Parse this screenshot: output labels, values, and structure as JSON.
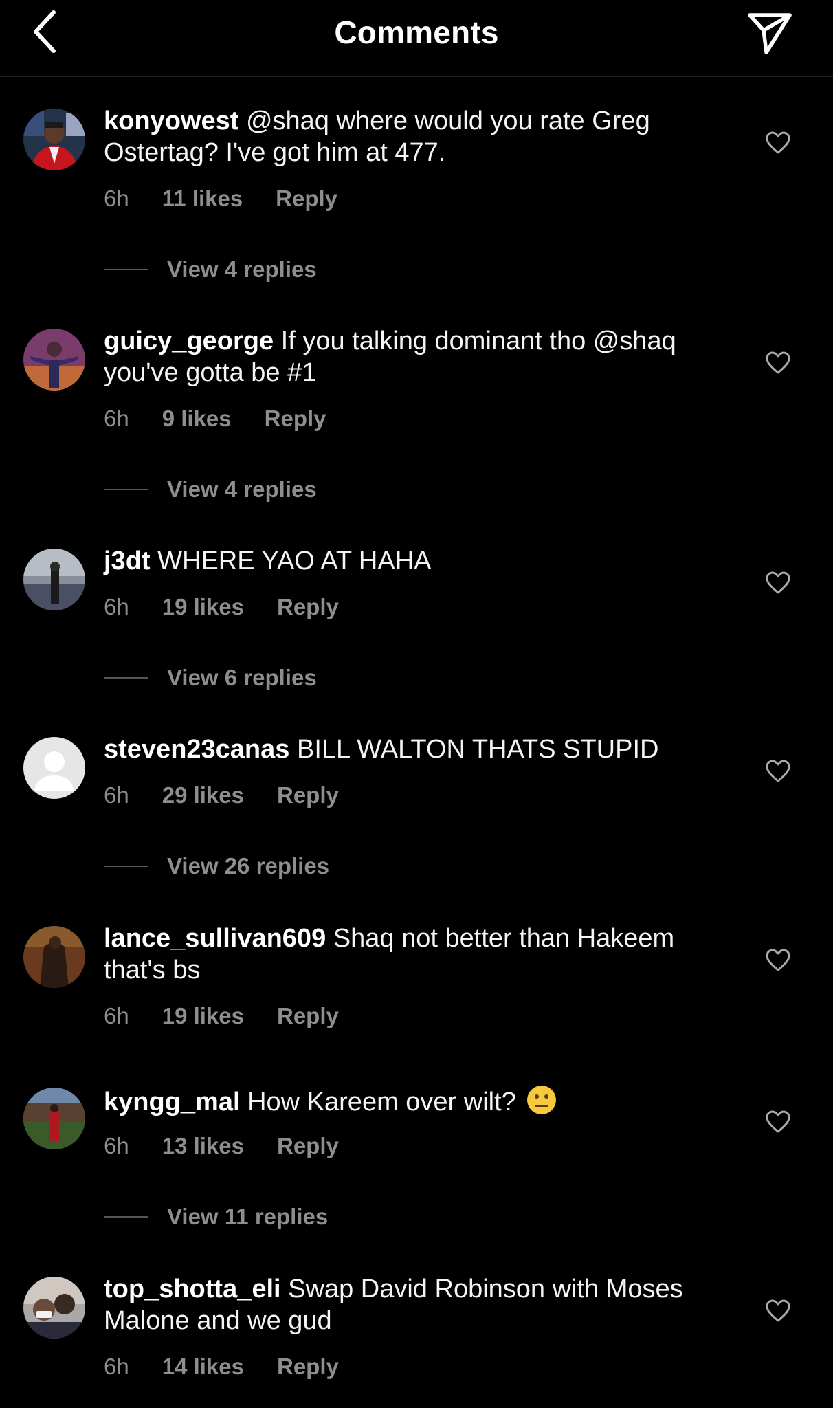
{
  "header": {
    "title": "Comments"
  },
  "comments": [
    {
      "username": "konyowest",
      "text": "@shaq where would you rate Greg Ostertag? I've got him at 477.",
      "time": "6h",
      "likes": "11 likes",
      "reply": "Reply",
      "view_replies": "View 4 replies"
    },
    {
      "username": "guicy_george",
      "text": "If you talking dominant tho @shaq you've gotta be #1",
      "time": "6h",
      "likes": "9 likes",
      "reply": "Reply",
      "view_replies": "View 4 replies"
    },
    {
      "username": "j3dt",
      "text": "WHERE YAO AT HAHA",
      "time": "6h",
      "likes": "19 likes",
      "reply": "Reply",
      "view_replies": "View 6 replies"
    },
    {
      "username": "steven23canas",
      "text": "BILL WALTON THATS STUPID",
      "time": "6h",
      "likes": "29 likes",
      "reply": "Reply",
      "view_replies": "View 26 replies"
    },
    {
      "username": "lance_sullivan609",
      "text": "Shaq not better than Hakeem that's bs",
      "time": "6h",
      "likes": "19 likes",
      "reply": "Reply",
      "view_replies": ""
    },
    {
      "username": "kyngg_mal",
      "text": "How Kareem over wilt?",
      "time": "6h",
      "likes": "13 likes",
      "reply": "Reply",
      "view_replies": "View 11 replies"
    },
    {
      "username": "top_shotta_eli",
      "text": "Swap David Robinson with Moses Malone and we gud",
      "time": "6h",
      "likes": "14 likes",
      "reply": "Reply",
      "view_replies": ""
    }
  ]
}
